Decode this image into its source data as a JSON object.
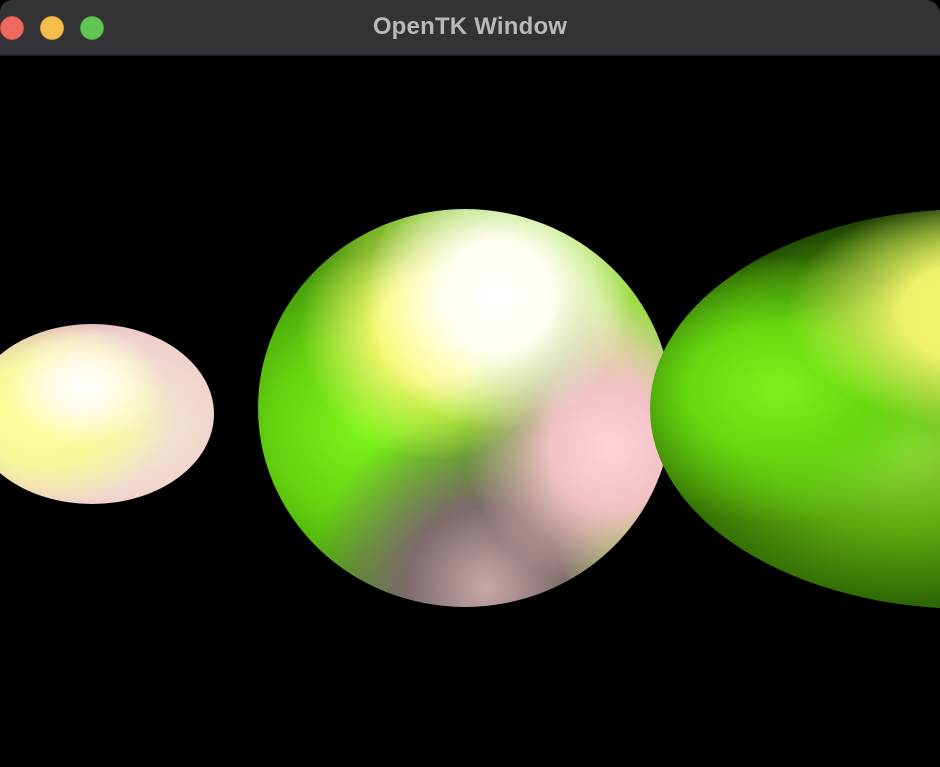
{
  "window": {
    "title": "OpenTK Window",
    "titlebar_color": "#323237",
    "buttons": {
      "close_color": "#ec6a5e",
      "minimize_color": "#f4bf4f",
      "zoom_color": "#61c554"
    }
  },
  "viewport": {
    "background_color": "#000000",
    "objects": [
      {
        "name": "sphere-left",
        "colors": [
          "#ffffff",
          "#ffff9a",
          "#efcfcc"
        ]
      },
      {
        "name": "sphere-center",
        "colors": [
          "#7cf51a",
          "#fdfd7a",
          "#ffffff",
          "#ffd3da"
        ]
      },
      {
        "name": "sphere-right",
        "colors": [
          "#7cf21a",
          "#f6f66d",
          "#2e6604"
        ]
      }
    ]
  }
}
